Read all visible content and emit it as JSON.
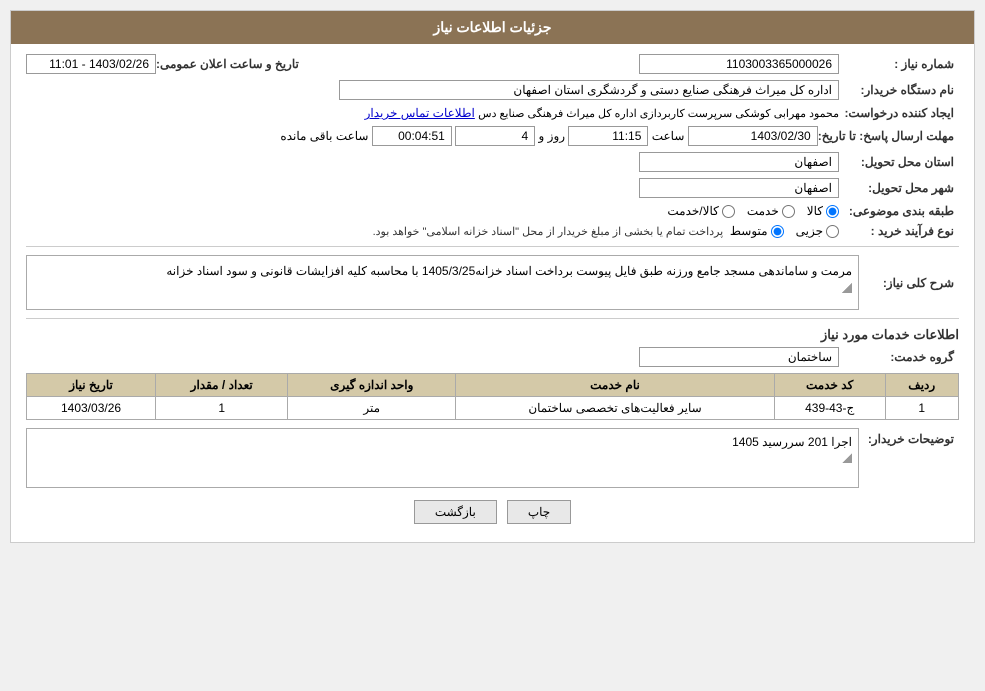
{
  "header": {
    "title": "جزئیات اطلاعات نیاز"
  },
  "fields": {
    "need_number_label": "شماره نیاز :",
    "need_number_value": "1103003365000026",
    "buyer_org_label": "نام دستگاه خریدار:",
    "buyer_org_value": "اداره کل میراث فرهنگی  صنایع دستی و گردشگری استان اصفهان",
    "creator_label": "ایجاد کننده درخواست:",
    "creator_value": "محمود مهرابی کوشکی سرپرست کاربردازی اداره کل میراث فرهنگی  صنایع دس",
    "creator_link": "اطلاعات تماس خریدار",
    "date_label": "تاریخ و ساعت اعلان عمومی:",
    "date_value": "1403/02/26 - 11:01",
    "response_deadline_label": "مهلت ارسال پاسخ: تا تاریخ:",
    "response_date": "1403/02/30",
    "response_time_label": "ساعت",
    "response_time": "11:15",
    "response_days_label": "روز و",
    "response_days": "4",
    "remaining_label": "ساعت باقی مانده",
    "remaining_time": "00:04:51",
    "delivery_province_label": "استان محل تحویل:",
    "delivery_province_value": "اصفهان",
    "delivery_city_label": "شهر محل تحویل:",
    "delivery_city_value": "اصفهان",
    "category_label": "طبقه بندی موضوعی:",
    "category_options": [
      "کالا",
      "خدمت",
      "کالا/خدمت"
    ],
    "category_selected": "کالا",
    "process_label": "نوع فرآیند خرید :",
    "process_options": [
      "جزیی",
      "متوسط"
    ],
    "process_notice": "پرداخت تمام یا بخشی از مبلغ خریدار از محل \"اسناد خزانه اسلامی\" خواهد بود.",
    "description_label": "شرح کلی نیاز:",
    "description_value": "مرمت و ساماندهی مسجد جامع ورزنه طبق فایل پیوست برداخت اسناد خزانه1405/3/25\nبا محاسبه کلیه افزایشات قانونی و سود اسناد خزانه",
    "services_section": "اطلاعات خدمات مورد نیاز",
    "service_group_label": "گروه خدمت:",
    "service_group_value": "ساختمان",
    "table": {
      "headers": [
        "ردیف",
        "کد خدمت",
        "نام خدمت",
        "واحد اندازه گیری",
        "تعداد / مقدار",
        "تاریخ نیاز"
      ],
      "rows": [
        {
          "row": "1",
          "code": "ج-43-439",
          "name": "سایر فعالیت‌های تخصصی ساختمان",
          "unit": "متر",
          "quantity": "1",
          "date": "1403/03/26"
        }
      ]
    },
    "buyer_desc_label": "توضیحات خریدار:",
    "buyer_desc_value": "اجرا 201 سررسید 1405"
  },
  "buttons": {
    "print_label": "چاپ",
    "back_label": "بازگشت"
  },
  "colors": {
    "header_bg": "#8B7355",
    "table_header_bg": "#d4c9a8"
  }
}
